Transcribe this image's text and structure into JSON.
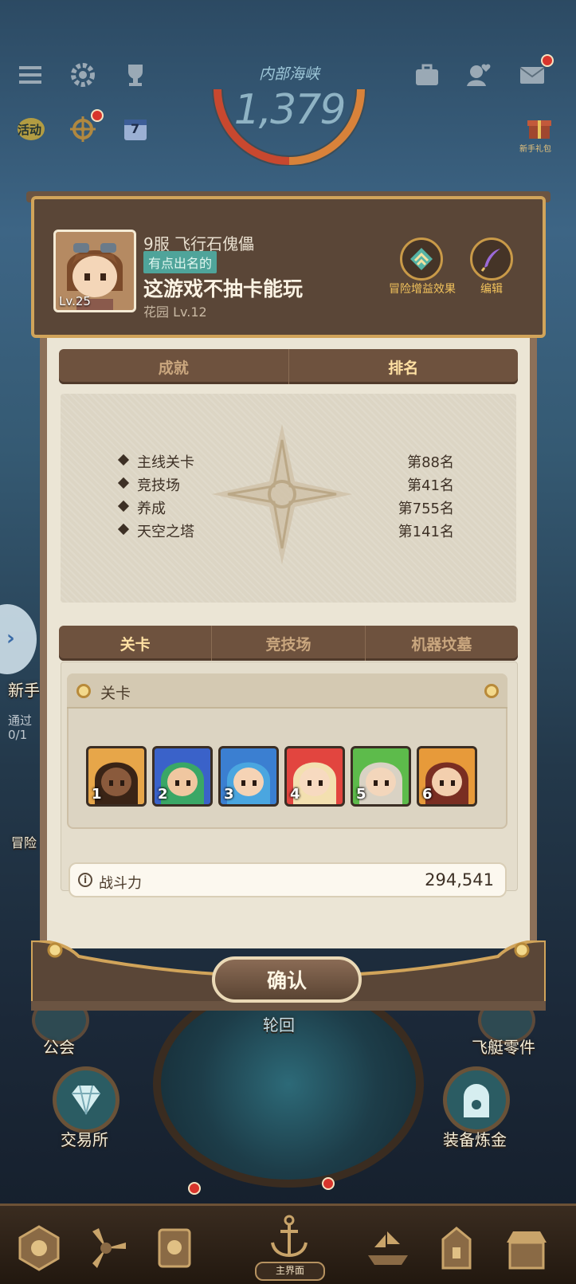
{
  "hud": {
    "gauge_title": "内部海峡",
    "gauge_value": "1,379",
    "activity_label": "活动",
    "calendar_day": "7",
    "gift_label": "新手礼包"
  },
  "background": {
    "guild_label": "公会",
    "exchange_label": "交易所",
    "reincarnation_label": "轮回",
    "airship_parts_label": "飞艇零件",
    "equip_refine_label": "装备炼金",
    "newbie_label": "新手",
    "pass_label": "通过",
    "pass_progress": "0/1",
    "adventure_label": "冒险",
    "main_menu_label": "主界面"
  },
  "profile": {
    "level": "Lv.25",
    "server_name": "9服 飞行石傀儡",
    "title_badge": "有点出名的",
    "player_name": "这游戏不抽卡能玩",
    "garden": "花园 Lv.12",
    "buff_label": "冒险增益效果",
    "edit_label": "编辑"
  },
  "top_tabs": [
    {
      "label": "成就",
      "active": false
    },
    {
      "label": "排名",
      "active": true
    }
  ],
  "rankings": [
    {
      "label": "主线关卡",
      "value": "第88名"
    },
    {
      "label": "竞技场",
      "value": "第41名"
    },
    {
      "label": "养成",
      "value": "第755名"
    },
    {
      "label": "天空之塔",
      "value": "第141名"
    }
  ],
  "bottom_tabs": [
    {
      "label": "关卡",
      "active": true
    },
    {
      "label": "竞技场",
      "active": false
    },
    {
      "label": "机器坟墓",
      "active": false
    }
  ],
  "stage": {
    "title": "关卡",
    "heroes": [
      {
        "slot": "1",
        "bg": "#e7a649",
        "hair": "#3a2416",
        "skin": "#8a5a3c"
      },
      {
        "slot": "2",
        "bg": "#3a62c9",
        "hair": "#3aa766",
        "skin": "#f0c7a0"
      },
      {
        "slot": "3",
        "bg": "#3b7fd1",
        "hair": "#4aa6e0",
        "skin": "#f5d3b5"
      },
      {
        "slot": "4",
        "bg": "#e2453f",
        "hair": "#f3e0b0",
        "skin": "#f7dac0"
      },
      {
        "slot": "5",
        "bg": "#5dbb4b",
        "hair": "#d9d2c4",
        "skin": "#f3d6bb"
      },
      {
        "slot": "6",
        "bg": "#e79a3a",
        "hair": "#7a2e22",
        "skin": "#f3cfae"
      }
    ],
    "power_label": "战斗力",
    "power_value": "294,541"
  },
  "confirm_label": "确认"
}
